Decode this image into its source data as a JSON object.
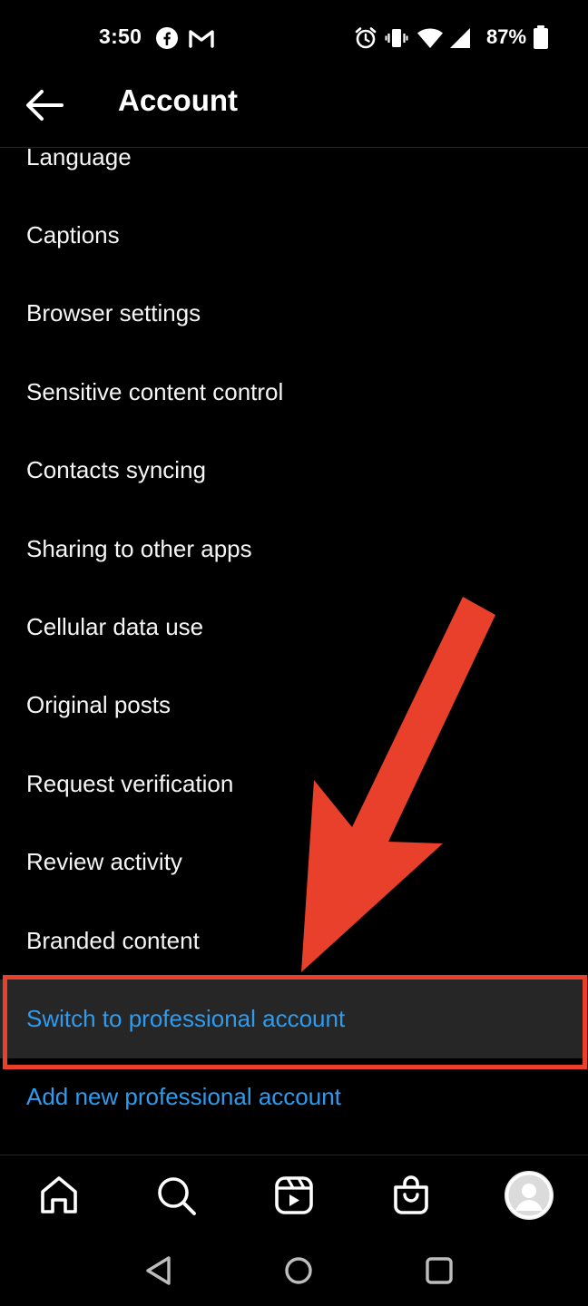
{
  "status_bar": {
    "time": "3:50",
    "battery_percent": "87%",
    "icons": [
      "facebook-icon",
      "gmail-icon",
      "alarm-icon",
      "vibrate-icon",
      "wifi-icon",
      "signal-icon",
      "battery-icon"
    ]
  },
  "header": {
    "title": "Account",
    "back_icon": "back-arrow-icon"
  },
  "settings": {
    "items": [
      {
        "label": "Language"
      },
      {
        "label": "Captions"
      },
      {
        "label": "Browser settings"
      },
      {
        "label": "Sensitive content control"
      },
      {
        "label": "Contacts syncing"
      },
      {
        "label": "Sharing to other apps"
      },
      {
        "label": "Cellular data use"
      },
      {
        "label": "Original posts"
      },
      {
        "label": "Request verification"
      },
      {
        "label": "Review activity"
      },
      {
        "label": "Branded content"
      },
      {
        "label": "Switch to professional account"
      },
      {
        "label": "Add new professional account"
      }
    ]
  },
  "bottom_nav": {
    "items": [
      "home-icon",
      "search-icon",
      "reels-icon",
      "shop-icon",
      "profile-avatar"
    ]
  },
  "system_nav": {
    "items": [
      "back-triangle-icon",
      "home-circle-icon",
      "recents-square-icon"
    ]
  },
  "colors": {
    "background": "#000000",
    "text": "#f5f5f5",
    "link_blue": "#2d9cf0",
    "highlight_row": "#262626",
    "annotation_red": "#e8402a"
  }
}
